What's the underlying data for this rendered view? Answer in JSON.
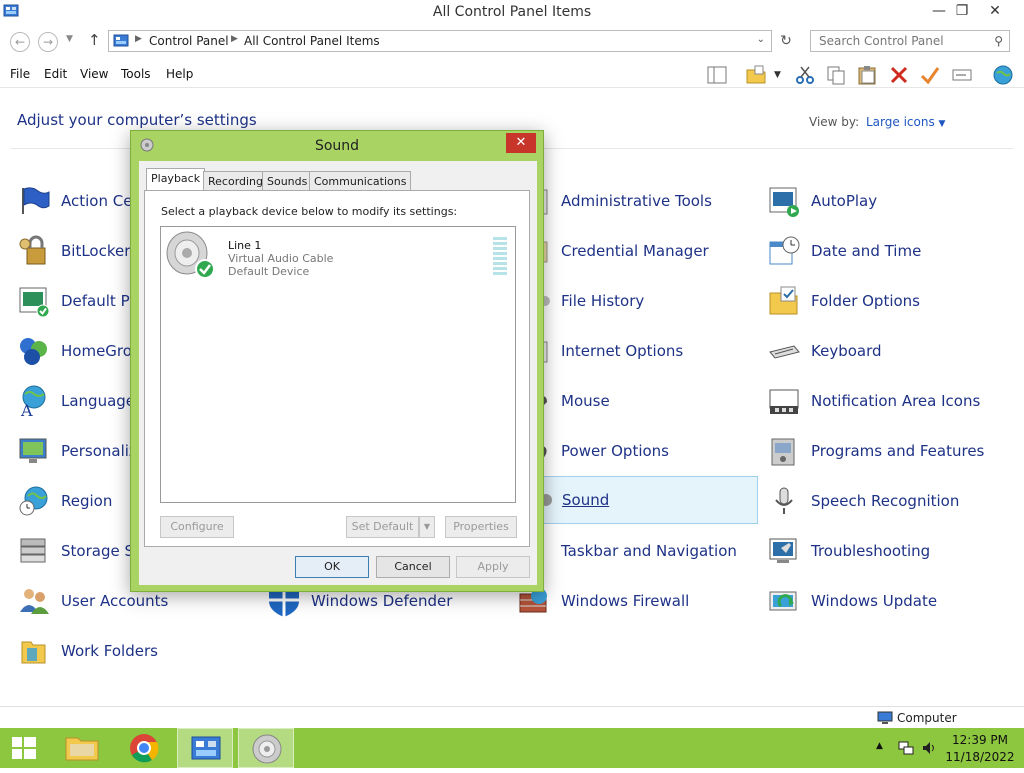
{
  "window": {
    "title": "All Control Panel Items",
    "controls": {
      "minimize": "—",
      "restore": "❐",
      "close": "✕"
    }
  },
  "address": {
    "crumbs": [
      "Control Panel",
      "All Control Panel Items"
    ],
    "search_placeholder": "Search Control Panel"
  },
  "menu": [
    "File",
    "Edit",
    "View",
    "Tools",
    "Help"
  ],
  "content": {
    "heading": "Adjust your computer’s settings",
    "view_by_label": "View by:",
    "view_by_value": "Large icons",
    "items": [
      "Action Center",
      "BitLocker Drive Encryption",
      "Default Programs",
      "HomeGroup",
      "Language",
      "Personalization",
      "Region",
      "Storage Spaces",
      "User Accounts",
      "Work Folders",
      "Windows Defender",
      "Administrative Tools",
      "Credential Manager",
      "File History",
      "Internet Options",
      "Mouse",
      "Power Options",
      "Sound",
      "Taskbar and Navigation",
      "Windows Firewall",
      "AutoPlay",
      "Date and Time",
      "Folder Options",
      "Keyboard",
      "Notification Area Icons",
      "Programs and Features",
      "Speech Recognition",
      "Troubleshooting",
      "Windows Update"
    ],
    "visible_labels": {
      "action_center": "Action Cei",
      "bitlocker": "BitLocker",
      "default_programs": "Default Pr",
      "homegroup": "HomeGro",
      "language": "Language",
      "personalization": "Personaliz",
      "region": "Region",
      "storage_spaces": "Storage S",
      "user_accounts": "User Accounts",
      "work_folders": "Work Folders",
      "windows_defender": "Windows Defender",
      "administrative_tools": "Administrative Tools",
      "credential_manager": "Credential Manager",
      "file_history": "File History",
      "internet_options": "Internet Options",
      "mouse": "Mouse",
      "power_options": "Power Options",
      "sound": "Sound",
      "taskbar_navigation": "Taskbar and Navigation",
      "windows_firewall": "Windows Firewall",
      "autoplay": "AutoPlay",
      "date_time": "Date and Time",
      "folder_options": "Folder Options",
      "keyboard": "Keyboard",
      "notification_area": "Notification Area Icons",
      "programs_features": "Programs and Features",
      "speech_recognition": "Speech Recognition",
      "troubleshooting": "Troubleshooting",
      "windows_update": "Windows Update"
    }
  },
  "status_bar": {
    "text": "Computer"
  },
  "taskbar": {
    "time": "12:39 PM",
    "date": "11/18/2022"
  },
  "dialog": {
    "title": "Sound",
    "close": "✕",
    "tabs": [
      "Playback",
      "Recording",
      "Sounds",
      "Communications"
    ],
    "instruction": "Select a playback device below to modify its settings:",
    "device": {
      "name": "Line 1",
      "description": "Virtual Audio Cable",
      "status": "Default Device"
    },
    "buttons": {
      "configure": "Configure",
      "set_default": "Set Default",
      "properties": "Properties",
      "ok": "OK",
      "cancel": "Cancel",
      "apply": "Apply"
    }
  },
  "colors": {
    "accent_green": "#8dc63f",
    "link_blue": "#1e3287",
    "close_red": "#c7352b"
  }
}
